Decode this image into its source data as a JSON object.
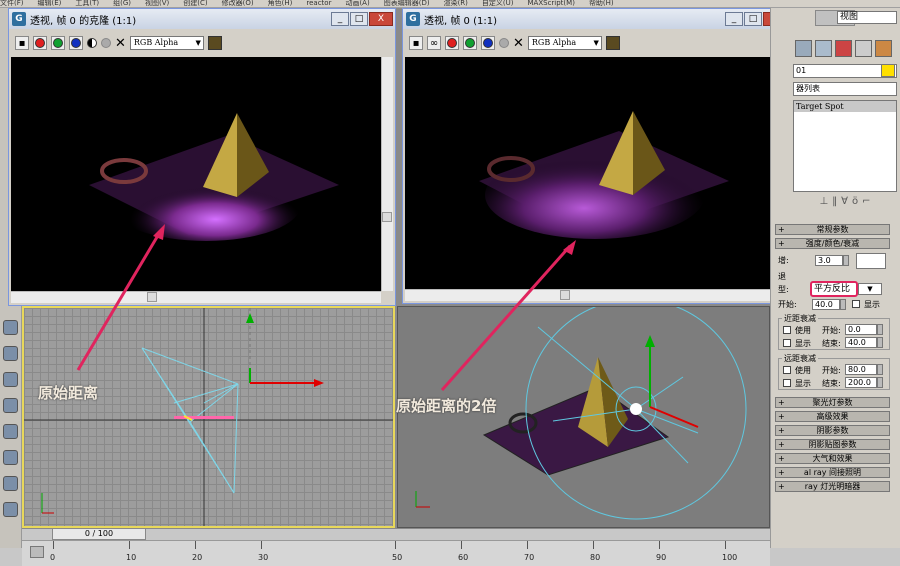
{
  "menubar": {
    "items": [
      "文件(F)",
      "编辑(E)",
      "工具(T)",
      "组(G)",
      "视图(V)",
      "创建(C)",
      "修改器(O)",
      "角色(H)",
      "reactor",
      "动画(A)",
      "图表编辑器(D)",
      "渲染(R)",
      "自定义(U)",
      "MAXScript(M)",
      "帮助(H)"
    ]
  },
  "frame_left": {
    "title": "透视, 帧 0 的克隆 (1:1)",
    "channel": "RGB Alpha",
    "annotation": "原始距离"
  },
  "frame_right": {
    "title": "透视, 帧 0 (1:1)",
    "channel": "RGB Alpha",
    "annotation": "原始距离的2倍"
  },
  "window_buttons": {
    "minimize": "_",
    "maximize": "□",
    "close": "X"
  },
  "timeline": {
    "slider_text": "0 / 100",
    "ticks": [
      "0",
      "10",
      "20",
      "30",
      "50",
      "60",
      "70",
      "80",
      "90",
      "100"
    ]
  },
  "command_panel": {
    "view_dropdown": "视图",
    "object_name": "01",
    "modifier_list": "器列表",
    "stack_item": "Target Spot",
    "rollouts": {
      "general": "常规参数",
      "intensity": "强度/颜色/衰减",
      "spotlight": "聚光灯参数",
      "advanced": "高级效果",
      "shadow": "阴影参数",
      "shadow_map": "阴影贴图参数",
      "atmosphere": "大气和效果",
      "mr_indirect": "al ray 间接照明",
      "mr_shader": "ray 灯光明暗器"
    },
    "multiplier_label": "增:",
    "multiplier_value": "3.0",
    "decay_group": "退",
    "decay_type_label": "型:",
    "decay_type_value": "平方反比",
    "decay_start_label": "开始:",
    "decay_start_value": "40.0",
    "show_label": "显示",
    "near_atten": {
      "title": "近距衰减",
      "use": "使用",
      "show": "显示",
      "start_label": "开始:",
      "start_value": "0.0",
      "end_label": "结束:",
      "end_value": "40.0"
    },
    "far_atten": {
      "title": "远距衰减",
      "use": "使用",
      "show": "显示",
      "start_label": "开始:",
      "start_value": "80.0",
      "end_label": "结束:",
      "end_value": "200.0"
    }
  },
  "colors": {
    "annotation_arrow": "#e0245e",
    "decay_highlight": "#e0245e",
    "viewport_border_active": "#e8d85a"
  }
}
